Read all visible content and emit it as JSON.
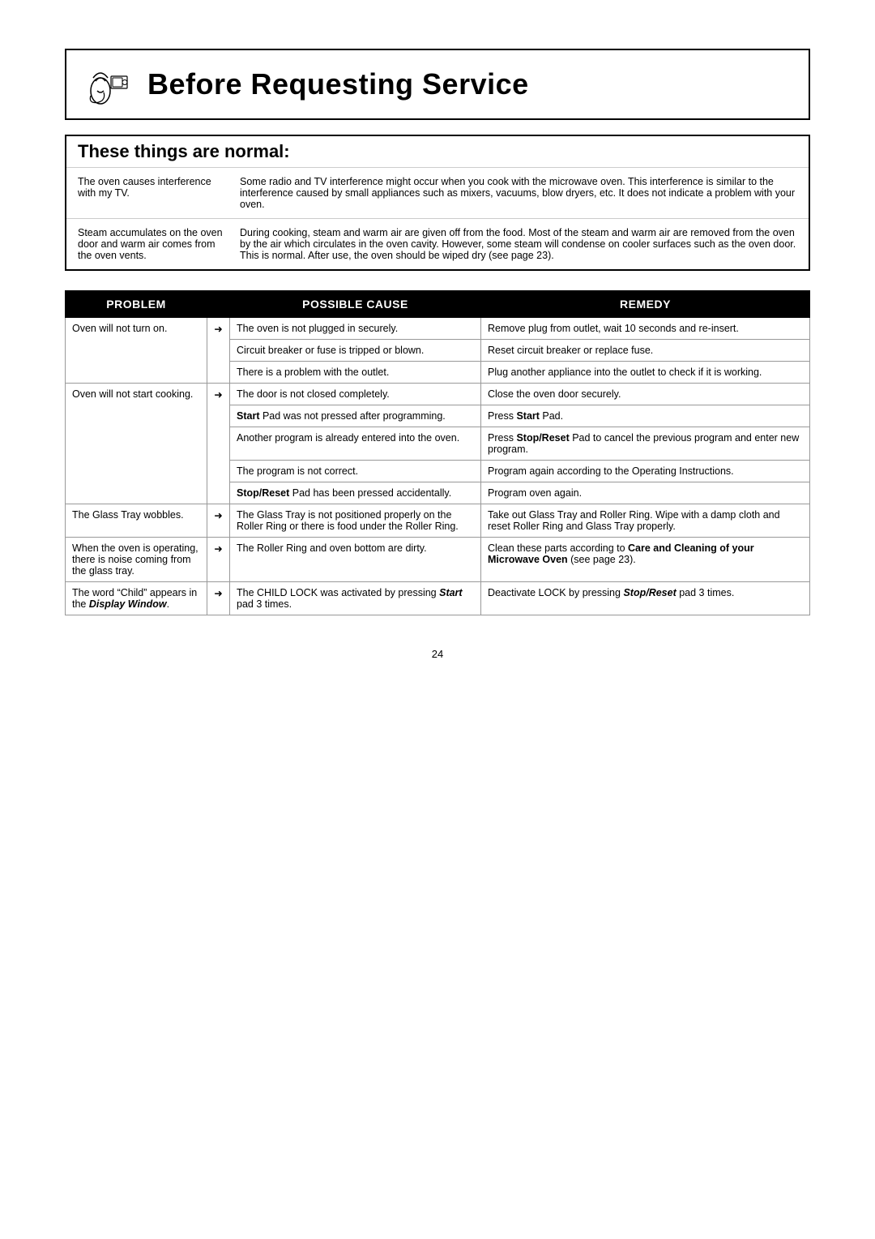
{
  "title": "Before Requesting Service",
  "normal_section": {
    "header": "These things are normal:",
    "rows": [
      {
        "left": "The oven causes interference with my TV.",
        "right": "Some radio and TV interference might occur when you cook with the microwave oven. This interference is similar to the interference caused by small appliances such as mixers, vacuums, blow dryers, etc. It does not indicate a problem with your oven."
      },
      {
        "left": "Steam accumulates on the oven door and warm air comes from the oven vents.",
        "right": "During cooking, steam and warm air are given off from the food. Most of the steam and warm air are removed from the oven by the air which circulates in the oven cavity. However, some steam will condense on cooler surfaces such as the oven door. This is normal. After use, the oven should be wiped dry (see page 23)."
      }
    ]
  },
  "table": {
    "headers": [
      "Problem",
      "Possible Cause",
      "Remedy"
    ],
    "problems": [
      {
        "label": "Oven will not turn on.",
        "causes": [
          "The oven is not plugged in securely.",
          "Circuit breaker or fuse is tripped or blown.",
          "There is a problem with the outlet."
        ],
        "remedies": [
          "Remove plug from outlet, wait 10 seconds and re-insert.",
          "Reset circuit breaker or replace fuse.",
          "Plug another appliance into the outlet to check if it is working."
        ]
      },
      {
        "label": "Oven will not start cooking.",
        "causes": [
          "The door is not closed completely.",
          "Start Pad was not pressed after programming.",
          "Another program is already entered into the oven.",
          "The program is not correct.",
          "Stop/Reset Pad has been pressed accidentally."
        ],
        "remedies": [
          "Close the oven door securely.",
          "Press Start Pad.",
          "Press Stop/Reset Pad to cancel the previous program and enter new program.",
          "Program again according to the Operating Instructions.",
          "Program oven again."
        ],
        "cause_bold": [
          false,
          true,
          false,
          false,
          true
        ],
        "cause_bold_word": [
          "",
          "Start",
          "",
          "",
          "Stop/Reset"
        ]
      },
      {
        "label": "The Glass Tray wobbles.",
        "causes": [
          "The Glass Tray is not positioned properly on the Roller Ring or there is food under the Roller Ring."
        ],
        "remedies": [
          "Take out Glass Tray and Roller Ring. Wipe with a damp cloth and reset Roller Ring and Glass Tray properly."
        ]
      },
      {
        "label": "When the oven is operating, there is noise coming from the glass tray.",
        "causes": [
          "The Roller Ring and oven bottom are dirty."
        ],
        "remedies": [
          "Clean these parts according to Care and Cleaning of your Microwave Oven (see page 23)."
        ],
        "remedy_bold": [
          true
        ]
      },
      {
        "label": "The word “Child” appears in the Display Window.",
        "label_bold_part": "Display Window",
        "causes": [
          "The CHILD LOCK was activated by pressing Start pad 3 times."
        ],
        "remedies": [
          "Deactivate LOCK by pressing Stop/Reset pad 3 times."
        ],
        "cause_bold_words": [
          "Start"
        ],
        "remedy_bold_words": [
          "Stop/Reset"
        ]
      }
    ]
  },
  "page_number": "24"
}
